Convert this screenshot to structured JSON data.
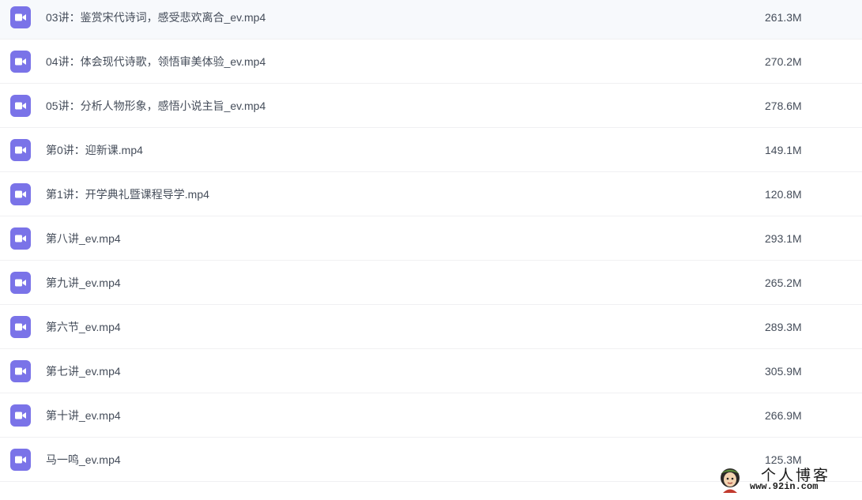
{
  "files": [
    {
      "name": "03讲：鉴赏宋代诗词，感受悲欢离合_ev.mp4",
      "size": "261.3M",
      "icon": "video-file-icon"
    },
    {
      "name": "04讲：体会现代诗歌，领悟审美体验_ev.mp4",
      "size": "270.2M",
      "icon": "video-file-icon"
    },
    {
      "name": "05讲：分析人物形象，感悟小说主旨_ev.mp4",
      "size": "278.6M",
      "icon": "video-file-icon"
    },
    {
      "name": "第0讲：迎新课.mp4",
      "size": "149.1M",
      "icon": "video-file-icon"
    },
    {
      "name": "第1讲：开学典礼暨课程导学.mp4",
      "size": "120.8M",
      "icon": "video-file-icon"
    },
    {
      "name": "第八讲_ev.mp4",
      "size": "293.1M",
      "icon": "video-file-icon"
    },
    {
      "name": "第九讲_ev.mp4",
      "size": "265.2M",
      "icon": "video-file-icon"
    },
    {
      "name": "第六节_ev.mp4",
      "size": "289.3M",
      "icon": "video-file-icon"
    },
    {
      "name": "第七讲_ev.mp4",
      "size": "305.9M",
      "icon": "video-file-icon"
    },
    {
      "name": "第十讲_ev.mp4",
      "size": "266.9M",
      "icon": "video-file-icon"
    },
    {
      "name": "马一鸣_ev.mp4",
      "size": "125.3M",
      "icon": "video-file-icon"
    }
  ],
  "watermark": {
    "title": "个人博客",
    "url": "www.92in.com"
  },
  "colors": {
    "icon_background": "#7a73e8",
    "icon_glyph": "#ffffff",
    "text": "#454d5a",
    "row_divider": "#f0f0f2"
  }
}
